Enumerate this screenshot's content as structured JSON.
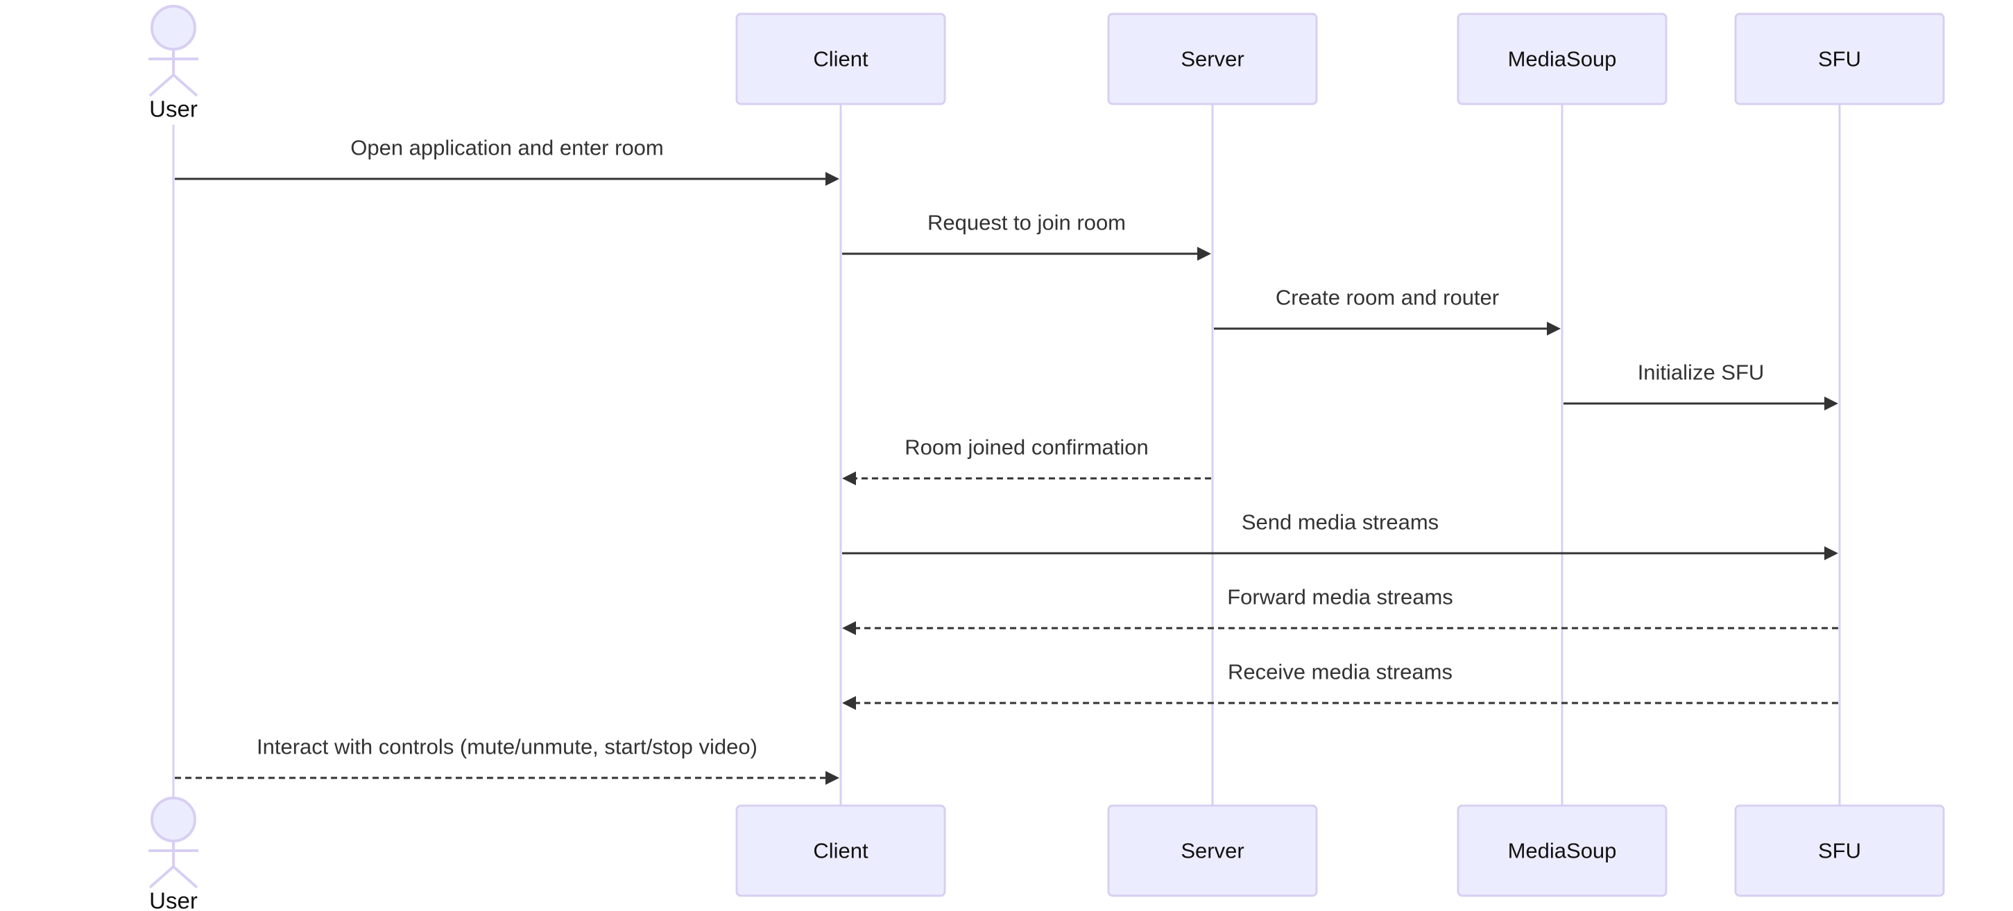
{
  "diagram": {
    "type": "sequence",
    "colors": {
      "participant_fill": "#ececff",
      "participant_stroke": "#d8cff3",
      "lifeline": "#d8cff3",
      "message": "#333333",
      "label_text": "#333333"
    },
    "participants": [
      {
        "id": "user",
        "label": "User",
        "kind": "actor"
      },
      {
        "id": "client",
        "label": "Client",
        "kind": "participant"
      },
      {
        "id": "server",
        "label": "Server",
        "kind": "participant"
      },
      {
        "id": "mediasoup",
        "label": "MediaSoup",
        "kind": "participant"
      },
      {
        "id": "sfu",
        "label": "SFU",
        "kind": "participant"
      }
    ],
    "messages": [
      {
        "from": "user",
        "to": "client",
        "label": "Open application and enter room",
        "style": "solid"
      },
      {
        "from": "client",
        "to": "server",
        "label": "Request to join room",
        "style": "solid"
      },
      {
        "from": "server",
        "to": "mediasoup",
        "label": "Create room and router",
        "style": "solid"
      },
      {
        "from": "mediasoup",
        "to": "sfu",
        "label": "Initialize SFU",
        "style": "solid"
      },
      {
        "from": "server",
        "to": "client",
        "label": "Room joined confirmation",
        "style": "dashed"
      },
      {
        "from": "client",
        "to": "sfu",
        "label": "Send media streams",
        "style": "solid"
      },
      {
        "from": "sfu",
        "to": "client",
        "label": "Forward media streams",
        "style": "dashed"
      },
      {
        "from": "sfu",
        "to": "client",
        "label": "Receive media streams",
        "style": "dashed"
      },
      {
        "from": "user",
        "to": "client",
        "label": "Interact with controls (mute/unmute, start/stop video)",
        "style": "dashed"
      }
    ]
  }
}
